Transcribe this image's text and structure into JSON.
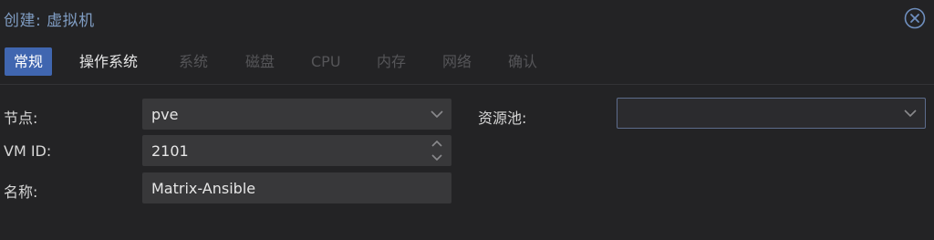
{
  "window": {
    "title": "创建: 虚拟机",
    "close_icon": "close-circle-icon"
  },
  "tabs": [
    {
      "label": "常规",
      "state": "active"
    },
    {
      "label": "操作系统",
      "state": "enabled"
    },
    {
      "label": "系统",
      "state": "disabled"
    },
    {
      "label": "磁盘",
      "state": "disabled"
    },
    {
      "label": "CPU",
      "state": "disabled"
    },
    {
      "label": "内存",
      "state": "disabled"
    },
    {
      "label": "网络",
      "state": "disabled"
    },
    {
      "label": "确认",
      "state": "disabled"
    }
  ],
  "form": {
    "node": {
      "label": "节点:",
      "value": "pve"
    },
    "vmid": {
      "label": "VM ID:",
      "value": "2101"
    },
    "name": {
      "label": "名称:",
      "value": "Matrix-Ansible"
    },
    "pool": {
      "label": "资源池:",
      "value": ""
    }
  },
  "colors": {
    "accent": "#4066b0",
    "title": "#7f9cc2",
    "background": "#232325",
    "field": "#38383a"
  }
}
